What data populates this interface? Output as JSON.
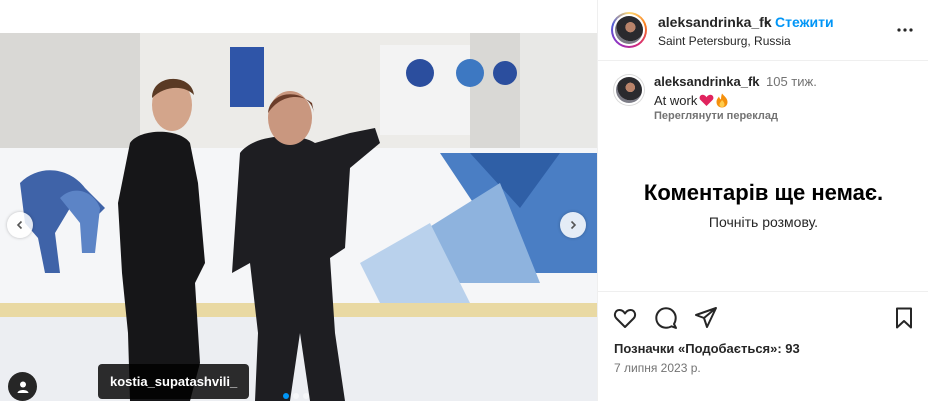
{
  "post": {
    "user_tag": "kostia_supatashvili_",
    "carousel": {
      "count": 3,
      "active_index": 0
    }
  },
  "header": {
    "username": "aleksandrinka_fk",
    "separator": "•",
    "follow_label": "Стежити",
    "location": "Saint Petersburg, Russia"
  },
  "caption": {
    "username": "aleksandrinka_fk",
    "time_ago": "105 тиж.",
    "text": "At work",
    "emojis": [
      "heart",
      "fire"
    ],
    "translate_label": "Переглянути переклад"
  },
  "comments": {
    "empty_title": "Коментарів ще немає.",
    "empty_subtitle": "Почніть розмову."
  },
  "footer": {
    "likes_label": "Позначки «Подобається»: 93",
    "date": "7 липня 2023 р."
  },
  "icons": {
    "like": "heart-outline-icon",
    "comment": "comment-bubble-icon",
    "share": "paper-plane-icon",
    "save": "bookmark-icon",
    "more": "ellipsis-icon"
  },
  "colors": {
    "accent": "#0095f6",
    "text": "#262626",
    "muted": "#737373",
    "border": "#efefef"
  }
}
